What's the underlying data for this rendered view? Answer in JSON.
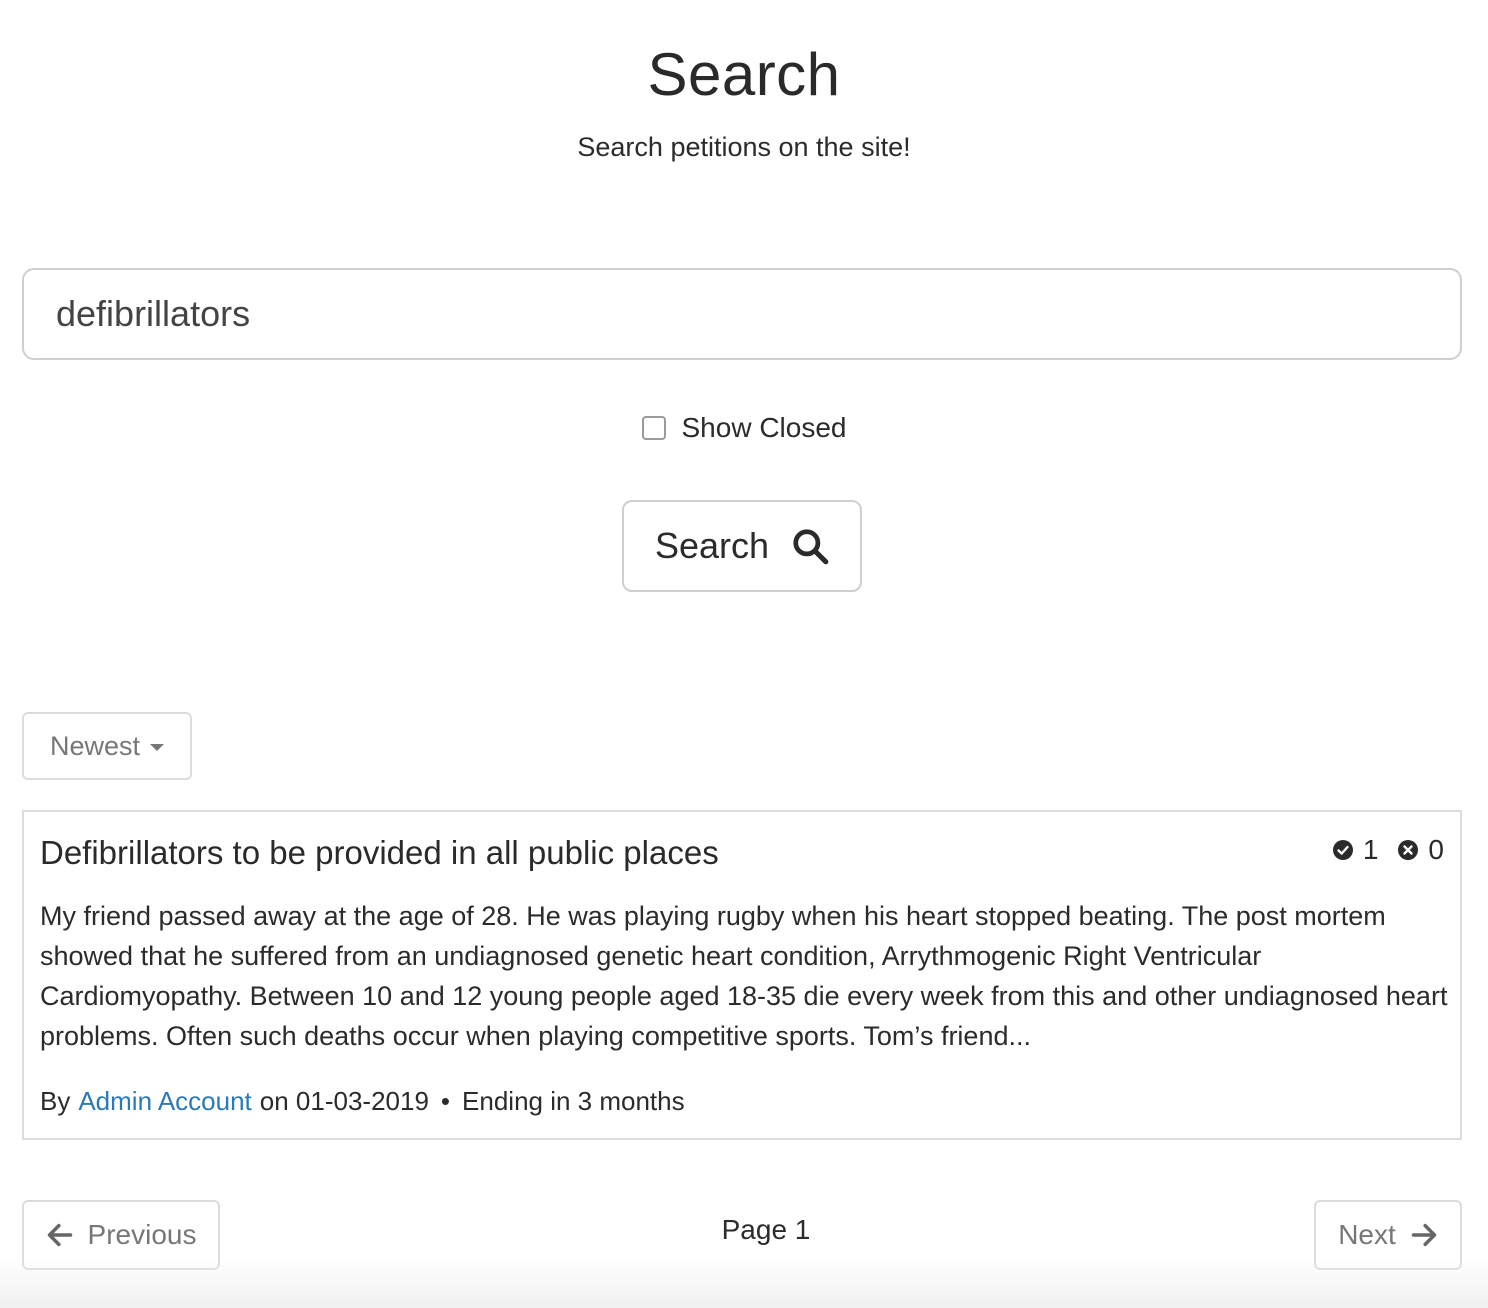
{
  "header": {
    "title": "Search",
    "subtitle": "Search petitions on the site!"
  },
  "search": {
    "value": "defibrillators",
    "show_closed_label": "Show Closed",
    "show_closed_checked": false,
    "button_label": "Search"
  },
  "sort": {
    "selected": "Newest"
  },
  "results": [
    {
      "title": "Defibrillators to be provided in all public places",
      "votes_up": "1",
      "votes_down": "0",
      "description": "My friend passed away at the age of 28. He was playing rugby when his heart stopped beating. The post mortem showed that he suffered from an undiagnosed genetic heart condition, Arrythmogenic Right Ventricular Cardiomyopathy. Between 10 and 12 young people aged 18-35 die every week from this and other undiagnosed heart problems. Often such deaths occur when playing competitive sports. Tom’s friend...",
      "by_label": "By",
      "author": "Admin Account",
      "date_text": "on 01-03-2019",
      "separator": "•",
      "ending": "Ending in 3 months"
    }
  ],
  "pagination": {
    "previous_label": "Previous",
    "next_label": "Next",
    "page_label": "Page 1"
  },
  "colors": {
    "link": "#2a7ab8",
    "border": "#dcdcdc",
    "muted_text": "#777777"
  }
}
